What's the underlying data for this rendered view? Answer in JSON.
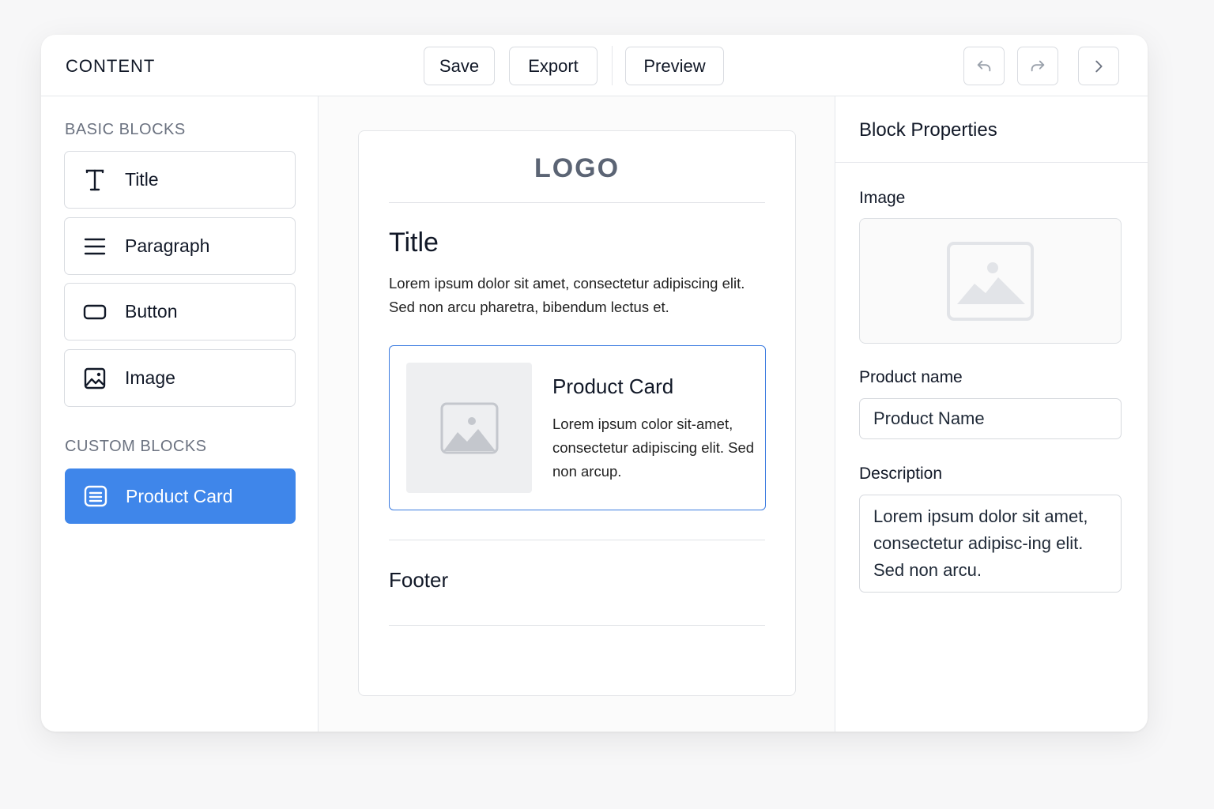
{
  "header": {
    "brand": "CONTENT",
    "save_label": "Save",
    "export_label": "Export",
    "preview_label": "Preview"
  },
  "sidebar": {
    "basic_heading": "BASIC BLOCKS",
    "basic_items": [
      {
        "label": "Title",
        "icon": "text-icon"
      },
      {
        "label": "Paragraph",
        "icon": "paragraph-icon"
      },
      {
        "label": "Button",
        "icon": "button-icon"
      },
      {
        "label": "Image",
        "icon": "image-icon"
      }
    ],
    "custom_heading": "CUSTOM BLOCKS",
    "custom_items": [
      {
        "label": "Product Card",
        "icon": "card-icon",
        "active": true
      }
    ]
  },
  "canvas": {
    "logo": "LOGO",
    "title": "Title",
    "paragraph": "Lorem ipsum dolor sit amet, consectetur adipiscing elit. Sed non arcu pharetra, bibendum lectus et.",
    "product_card": {
      "title": "Product Card",
      "description": "Lorem ipsum color sit-amet, consectetur adipiscing elit. Sed non arcup."
    },
    "footer": "Footer"
  },
  "properties": {
    "title": "Block Properties",
    "image_label": "Image",
    "product_name_label": "Product name",
    "product_name_value": "Product Name",
    "description_label": "Description",
    "description_value": "Lorem ipsum dolor sit amet, consectetur adipisc-ing elit. Sed non arcu."
  },
  "colors": {
    "accent": "#3f86ea",
    "selection_border": "#3b7be0",
    "muted_text": "#6b7280"
  }
}
